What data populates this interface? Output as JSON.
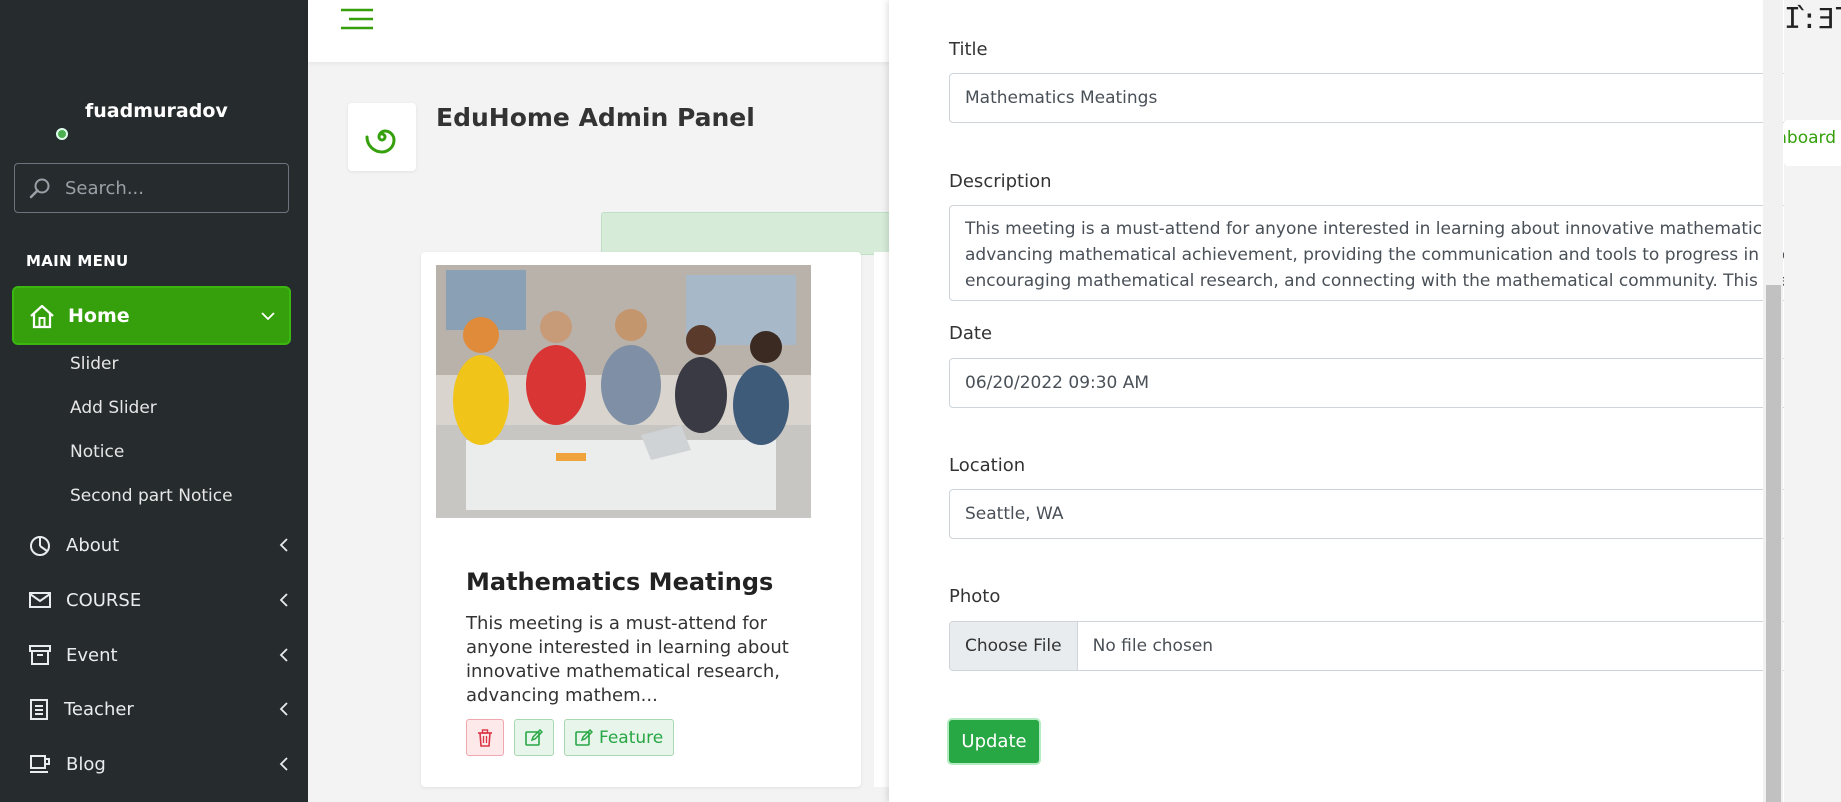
{
  "sidebar": {
    "user_name": "fuadmuradov",
    "search_placeholder": "Search...",
    "menu_header": "MAIN MENU",
    "home_label": "Home",
    "sub_items": [
      "Slider",
      "Add Slider",
      "Notice",
      "Second part Notice"
    ],
    "nav_items": [
      "About",
      "COURSE",
      "Event",
      "Teacher",
      "Blog"
    ]
  },
  "main": {
    "panel_title": "EduHome Admin Panel",
    "card": {
      "title": "Mathematics Meatings",
      "text": "This meeting is a must-attend for anyone interested in learning about innovative mathematical research, advancing mathem...",
      "feature_label": "Feature"
    }
  },
  "modal": {
    "title_label": "Title",
    "title_value": "Mathematics Meatings",
    "description_label": "Description",
    "description_lines": [
      "This meeting is a must-attend for anyone interested in learning about innovative mathematical researc",
      "advancing mathematical achievement, providing the communication and tools to progress in the field,",
      "encouraging mathematical research, and connecting with the mathematical community. This meeting is"
    ],
    "date_label": "Date",
    "date_value": "06/20/2022 09:30  AM",
    "location_label": "Location",
    "location_value": "Seattle, WA",
    "photo_label": "Photo",
    "choose_file_label": "Choose File",
    "no_file_text": "No file chosen",
    "update_label": "Update"
  },
  "right_edge": {
    "clock_fragment": "ΓE:Ί",
    "dashboard_fragment": "nboard"
  },
  "colors": {
    "sidebar_bg": "#262b2e",
    "accent_green": "#35a00c",
    "success": "#28a745"
  }
}
